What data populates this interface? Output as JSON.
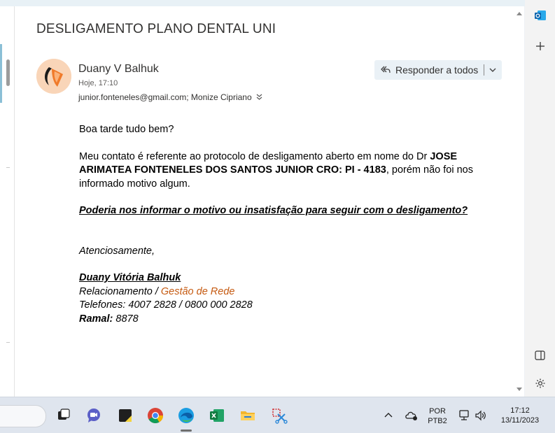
{
  "email": {
    "subject": "DESLIGAMENTO PLANO DENTAL UNI",
    "sender": "Duany V Balhuk",
    "time": "Hoje, 17:10",
    "recipients": "junior.fonteneles@gmail.com; Monize Cipriano",
    "reply_all_label": "Responder a todos"
  },
  "body": {
    "greeting": "Boa tarde tudo bem?",
    "p1_a": "Meu contato é referente ao protocolo de desligamento aberto em nome do Dr ",
    "p1_bold": "JOSE ARIMATEA FONTENELES DOS SANTOS JUNIOR CRO: PI - 4183",
    "p1_b": ", porém não foi nos informado motivo algum.",
    "question": "Poderia nos informar o motivo ou insatisfação para seguir com o desligamento? ",
    "closing": "Atenciosamente,",
    "sig_name": "Duany Vitória Balhuk ",
    "sig_role_a": "Relacionamento / ",
    "sig_role_b": "Gestão de Rede",
    "sig_phones": "Telefones: 4007 2828 / 0800 000 2828",
    "sig_ramal_label": "Ramal:",
    "sig_ramal_value": " 8878"
  },
  "taskbar": {
    "lang_top": "POR",
    "lang_bottom": "PTB2",
    "clock_time": "17:12",
    "clock_date": "13/11/2023"
  },
  "colors": {
    "accent": "#0f6cbd",
    "signature_orange": "#c55a11",
    "reply_bg": "#eaf1f6"
  }
}
